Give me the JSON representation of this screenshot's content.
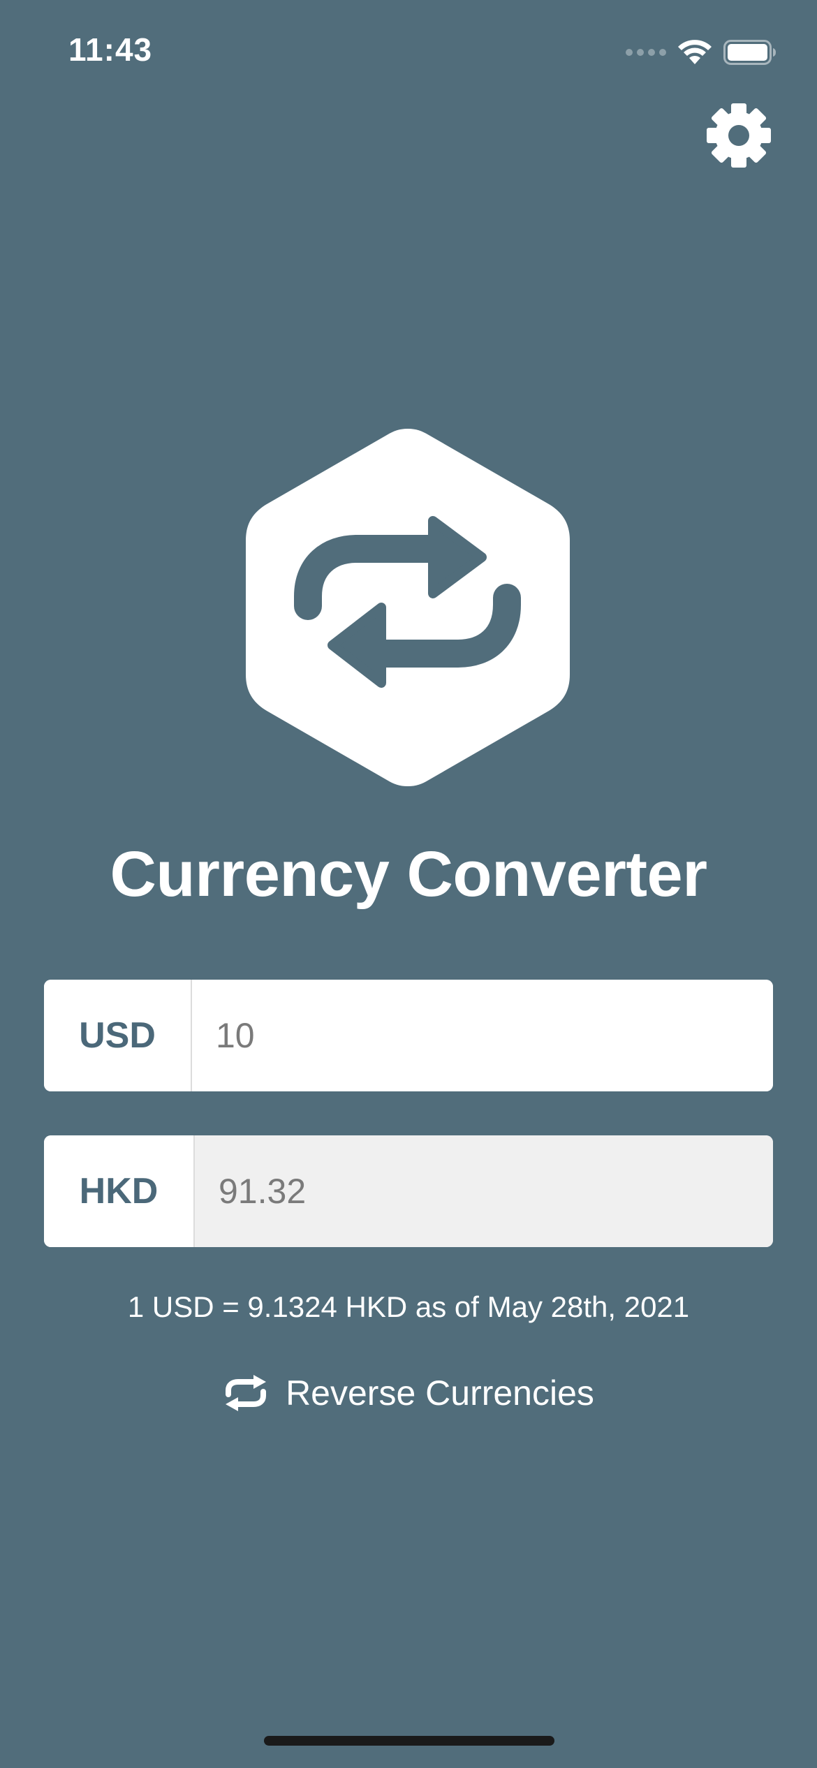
{
  "status_bar": {
    "time": "11:43"
  },
  "header": {
    "settings_icon": "gear-icon"
  },
  "logo": {
    "icon": "swap-arrows-icon"
  },
  "app": {
    "title": "Currency Converter"
  },
  "converter": {
    "base": {
      "code": "USD",
      "value": "10"
    },
    "quote": {
      "code": "HKD",
      "value": "91.32"
    },
    "rate_text": "1 USD = 9.1324 HKD as of May 28th, 2021",
    "reverse_label": "Reverse Currencies"
  },
  "colors": {
    "background": "#516d7b",
    "accent_text": "#4b6879",
    "input_bg": "#ffffff",
    "readonly_bg": "#f0f0f0"
  }
}
